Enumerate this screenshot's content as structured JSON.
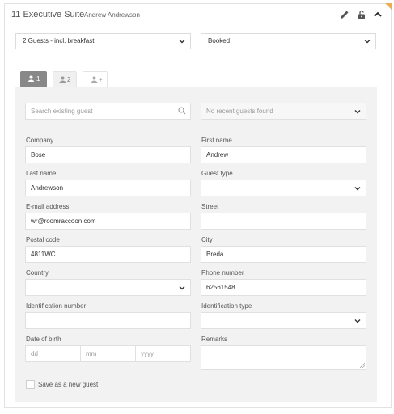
{
  "header": {
    "room": "11 Executive Suite",
    "guest_name": "Andrew Andrewson",
    "icons": [
      "pencil-icon",
      "unlock-icon",
      "chevron-up-icon"
    ]
  },
  "rate_select": {
    "value": "2 Guests - incl. breakfast"
  },
  "status_select": {
    "value": "Booked"
  },
  "tabs": [
    {
      "label": "1",
      "icon": "person-icon"
    },
    {
      "label": "2",
      "icon": "person-icon"
    },
    {
      "label": "+",
      "icon": "person-icon"
    }
  ],
  "search": {
    "placeholder": "Search existing guest"
  },
  "recent": {
    "value": "No recent guests found"
  },
  "form": {
    "company": {
      "label": "Company",
      "value": "Bose"
    },
    "first_name": {
      "label": "First name",
      "value": "Andrew"
    },
    "last_name": {
      "label": "Last name",
      "value": "Andrewson"
    },
    "guest_type": {
      "label": "Guest type",
      "value": ""
    },
    "email": {
      "label": "E-mail address",
      "value": "wr@roomraccoon.com"
    },
    "street": {
      "label": "Street",
      "value": ""
    },
    "postal_code": {
      "label": "Postal code",
      "value": "4811WC"
    },
    "city": {
      "label": "City",
      "value": "Breda"
    },
    "country": {
      "label": "Country",
      "value": ""
    },
    "phone": {
      "label": "Phone number",
      "value": "62561548"
    },
    "id_number": {
      "label": "Identification number",
      "value": ""
    },
    "id_type": {
      "label": "Identification type",
      "value": ""
    },
    "dob": {
      "label": "Date of birth",
      "day_ph": "dd",
      "month_ph": "mm",
      "year_ph": "yyyy"
    },
    "remarks": {
      "label": "Remarks",
      "value": ""
    },
    "save_new": {
      "label": "Save as a new guest",
      "checked": false
    }
  },
  "colors": {
    "accent_corner": "#f0ad4e",
    "active_tab": "#888888",
    "form_bg": "#f2f2f2"
  }
}
